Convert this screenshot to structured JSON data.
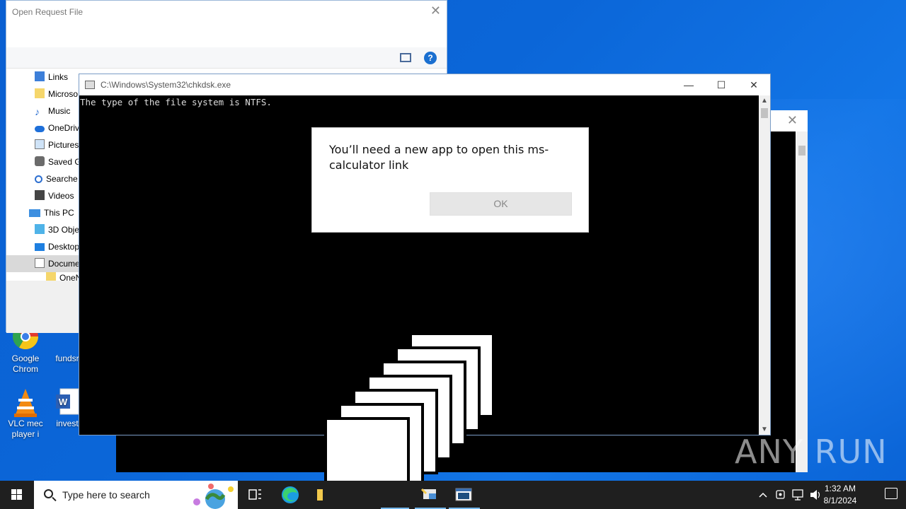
{
  "file_dialog": {
    "title": "Open Request File",
    "nav_items": [
      {
        "label": "Links",
        "icon": "links-icon"
      },
      {
        "label": "Microso",
        "icon": "folder-icon"
      },
      {
        "label": "Music",
        "icon": "music-icon"
      },
      {
        "label": "OneDriv",
        "icon": "onedrive-icon"
      },
      {
        "label": "Pictures",
        "icon": "pictures-icon"
      },
      {
        "label": "Saved G",
        "icon": "saved-games-icon"
      },
      {
        "label": "Searche",
        "icon": "searches-icon"
      },
      {
        "label": "Videos",
        "icon": "videos-icon"
      },
      {
        "label": "This PC",
        "icon": "this-pc-icon"
      },
      {
        "label": "3D Obje",
        "icon": "3d-objects-icon"
      },
      {
        "label": "Desktop",
        "icon": "desktop-icon"
      },
      {
        "label": "Docume",
        "icon": "documents-icon"
      },
      {
        "label": "OneNo",
        "icon": "folder-icon"
      }
    ]
  },
  "console": {
    "title": "C:\\Windows\\System32\\chkdsk.exe",
    "output": "The type of the file system is NTFS."
  },
  "dialog": {
    "message": "You’ll need a new app to open this ms-calculator link",
    "ok_label": "OK"
  },
  "desktop_icons": [
    {
      "label": "Google Chrom",
      "icon": "chrome-icon"
    },
    {
      "label": "fundsr",
      "icon": "file-icon"
    },
    {
      "label": "VLC mec player i",
      "icon": "vlc-icon"
    },
    {
      "label": "invest",
      "icon": "word-doc-icon"
    }
  ],
  "taskbar": {
    "search_placeholder": "Type here to search",
    "time": "1:32 AM",
    "date": "8/1/2024"
  },
  "watermark": "ANY RUN",
  "colors": {
    "desktop": "#0b66d8",
    "taskbar": "#1f1f1f",
    "accent": "#76b9ed"
  }
}
